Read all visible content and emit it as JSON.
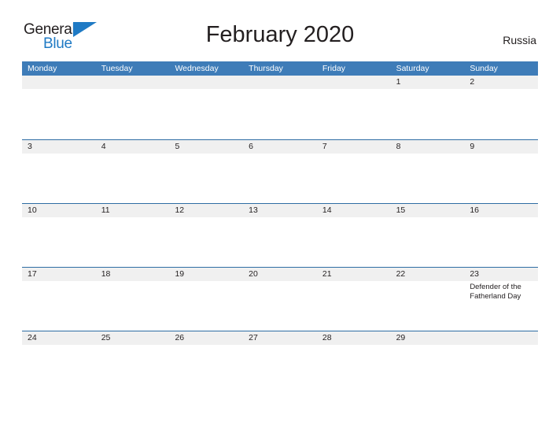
{
  "brand": {
    "name_top": "General",
    "name_bottom": "Blue",
    "flag_icon": "blue-triangle-flag-icon",
    "color_text": "#231f20",
    "color_blue": "#1f7ac4"
  },
  "header": {
    "title": "February 2020",
    "country": "Russia"
  },
  "calendar": {
    "header_bg": "#3e7cb8",
    "band_bg": "#f0f0f0",
    "rule_color": "#2e6da4",
    "weekdays": [
      "Monday",
      "Tuesday",
      "Wednesday",
      "Thursday",
      "Friday",
      "Saturday",
      "Sunday"
    ],
    "weeks": [
      [
        {
          "day": ""
        },
        {
          "day": ""
        },
        {
          "day": ""
        },
        {
          "day": ""
        },
        {
          "day": ""
        },
        {
          "day": "1"
        },
        {
          "day": "2"
        }
      ],
      [
        {
          "day": "3"
        },
        {
          "day": "4"
        },
        {
          "day": "5"
        },
        {
          "day": "6"
        },
        {
          "day": "7"
        },
        {
          "day": "8"
        },
        {
          "day": "9"
        }
      ],
      [
        {
          "day": "10"
        },
        {
          "day": "11"
        },
        {
          "day": "12"
        },
        {
          "day": "13"
        },
        {
          "day": "14"
        },
        {
          "day": "15"
        },
        {
          "day": "16"
        }
      ],
      [
        {
          "day": "17"
        },
        {
          "day": "18"
        },
        {
          "day": "19"
        },
        {
          "day": "20"
        },
        {
          "day": "21"
        },
        {
          "day": "22"
        },
        {
          "day": "23",
          "event": "Defender of the Fatherland Day"
        }
      ],
      [
        {
          "day": "24"
        },
        {
          "day": "25"
        },
        {
          "day": "26"
        },
        {
          "day": "27"
        },
        {
          "day": "28"
        },
        {
          "day": "29"
        },
        {
          "day": ""
        }
      ]
    ]
  }
}
